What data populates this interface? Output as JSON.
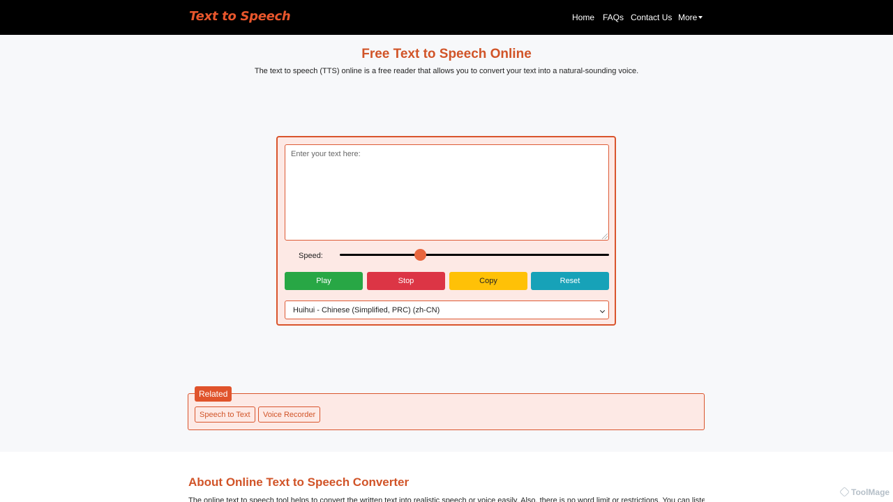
{
  "nav": {
    "brand": "Text to Speech",
    "links": [
      "Home",
      "FAQs",
      "Contact Us"
    ],
    "more": "More"
  },
  "hero": {
    "title": "Free Text to Speech Online",
    "subtitle": "The text to speech (TTS) online is a free reader that allows you to convert your text into a natural-sounding voice."
  },
  "tool": {
    "textarea_placeholder": "Enter your text here:",
    "textarea_value": "",
    "speed_label": "Speed:",
    "speed_level": 0.3,
    "buttons": {
      "play": "Play",
      "stop": "Stop",
      "copy": "Copy",
      "reset": "Reset"
    },
    "voice": "Huihui - Chinese (Simplified, PRC) (zh-CN)"
  },
  "related": {
    "label": "Related",
    "links": [
      "Speech to Text",
      "Voice Recorder"
    ]
  },
  "about": {
    "title": "About Online Text to Speech Converter",
    "text": "The online text to speech tool helps to convert the written text into realistic speech or voice easily. Also, there is no word limit or restrictions. You can listen to"
  },
  "watermark": "ToolMage",
  "colors": {
    "accent": "#d9542c",
    "play": "#28a745",
    "stop": "#dc3545",
    "copy": "#ffc107",
    "reset": "#17a2b8"
  }
}
